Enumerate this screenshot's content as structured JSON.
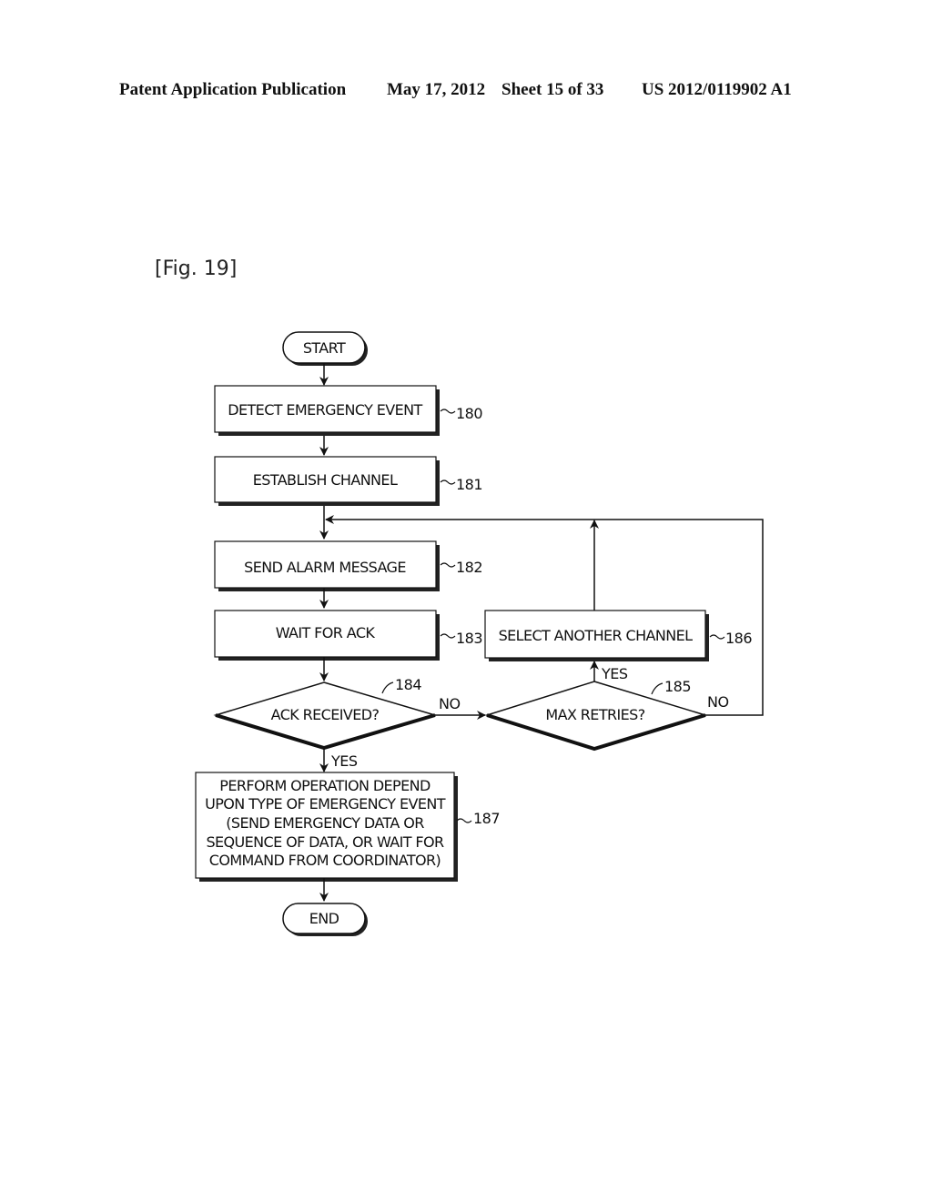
{
  "header": {
    "publication": "Patent Application Publication",
    "date": "May 17, 2012",
    "sheet": "Sheet 15 of 33",
    "number": "US 2012/0119902 A1"
  },
  "figure": {
    "label": "[Fig. 19]"
  },
  "flowchart": {
    "start": "START",
    "end": "END",
    "steps": {
      "s180": {
        "text": "DETECT EMERGENCY EVENT",
        "ref": "180"
      },
      "s181": {
        "text": "ESTABLISH CHANNEL",
        "ref": "181"
      },
      "s182": {
        "text": "SEND ALARM MESSAGE",
        "ref": "182"
      },
      "s183": {
        "text": "WAIT FOR ACK",
        "ref": "183"
      },
      "s186": {
        "text": "SELECT ANOTHER CHANNEL",
        "ref": "186"
      },
      "s187": {
        "lines": [
          "PERFORM OPERATION DEPEND",
          "UPON TYPE OF EMERGENCY EVENT",
          "(SEND EMERGENCY DATA OR",
          "SEQUENCE OF DATA, OR WAIT FOR",
          "COMMAND FROM COORDINATOR)"
        ],
        "ref": "187"
      }
    },
    "decisions": {
      "d184": {
        "text": "ACK RECEIVED?",
        "ref": "184",
        "yes": "YES",
        "no": "NO"
      },
      "d185": {
        "text": "MAX RETRIES?",
        "ref": "185",
        "yes": "YES",
        "no": "NO"
      }
    }
  }
}
